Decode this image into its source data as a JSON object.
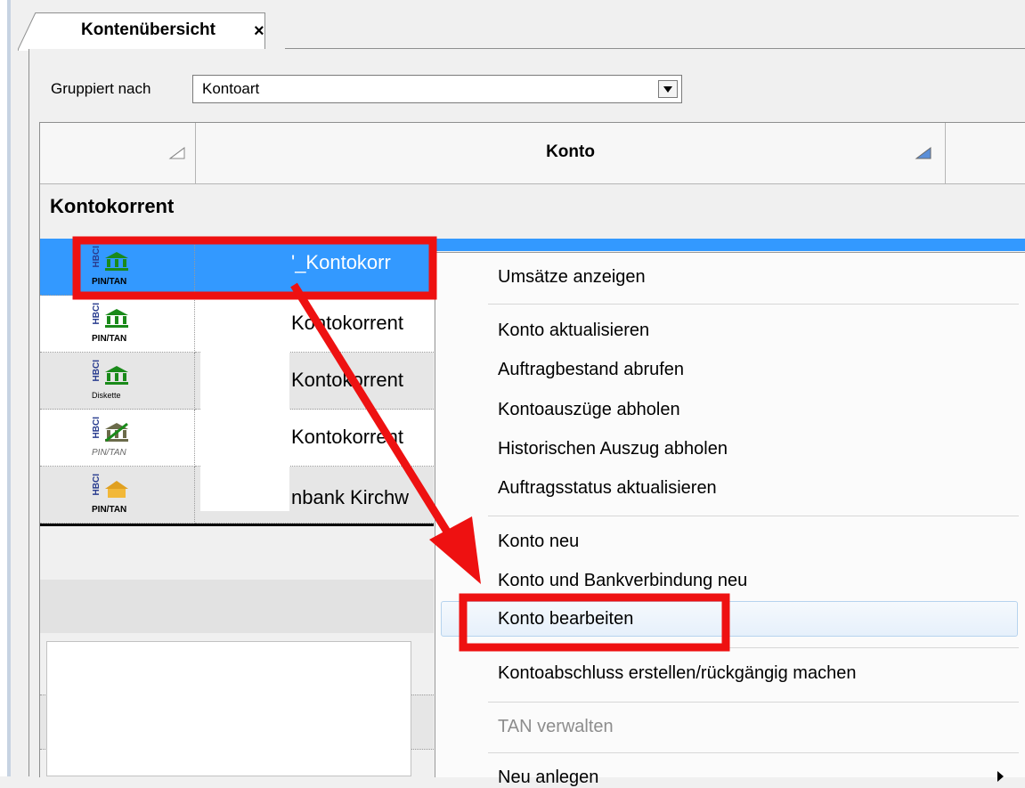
{
  "tab": {
    "title": "Kontenübersicht",
    "close": "×"
  },
  "grouping": {
    "label": "Gruppiert nach",
    "value": "Kontoart"
  },
  "grid": {
    "header": {
      "konto": "Konto"
    },
    "group_title": "Kontokorrent",
    "rows": [
      {
        "badge": "HBCI",
        "auth": "PIN/TAN",
        "text": "'_Kontokorr",
        "icon": "bank-icon",
        "selected": true
      },
      {
        "badge": "HBCI",
        "auth": "PIN/TAN",
        "text": "Kontokorrent",
        "icon": "bank-icon"
      },
      {
        "badge": "HBCI",
        "auth": "Diskette",
        "text": "Kontokorrent",
        "icon": "bank-icon"
      },
      {
        "badge": "HBCI",
        "auth": "PIN/TAN",
        "text": "Kontokorrent",
        "icon": "bank-broken-icon"
      },
      {
        "badge": "HBCI",
        "auth": "PIN/TAN",
        "text": "nbank Kirchw",
        "icon": "house-icon"
      }
    ]
  },
  "context_menu": {
    "items": [
      "Umsätze anzeigen",
      "Konto aktualisieren",
      "Auftragbestand abrufen",
      "Kontoauszüge abholen",
      "Historischen Auszug abholen",
      "Auftragsstatus aktualisieren",
      "Konto neu",
      "Konto und Bankverbindung neu",
      "Konto bearbeiten",
      "Kontoabschluss erstellen/rückgängig machen",
      "TAN verwalten",
      "Neu anlegen"
    ],
    "highlighted": "Konto bearbeiten",
    "disabled": [
      "TAN verwalten"
    ]
  },
  "colors": {
    "selection": "#3399ff",
    "annotation": "#ee1111",
    "bank_green": "#1a8a1a"
  }
}
